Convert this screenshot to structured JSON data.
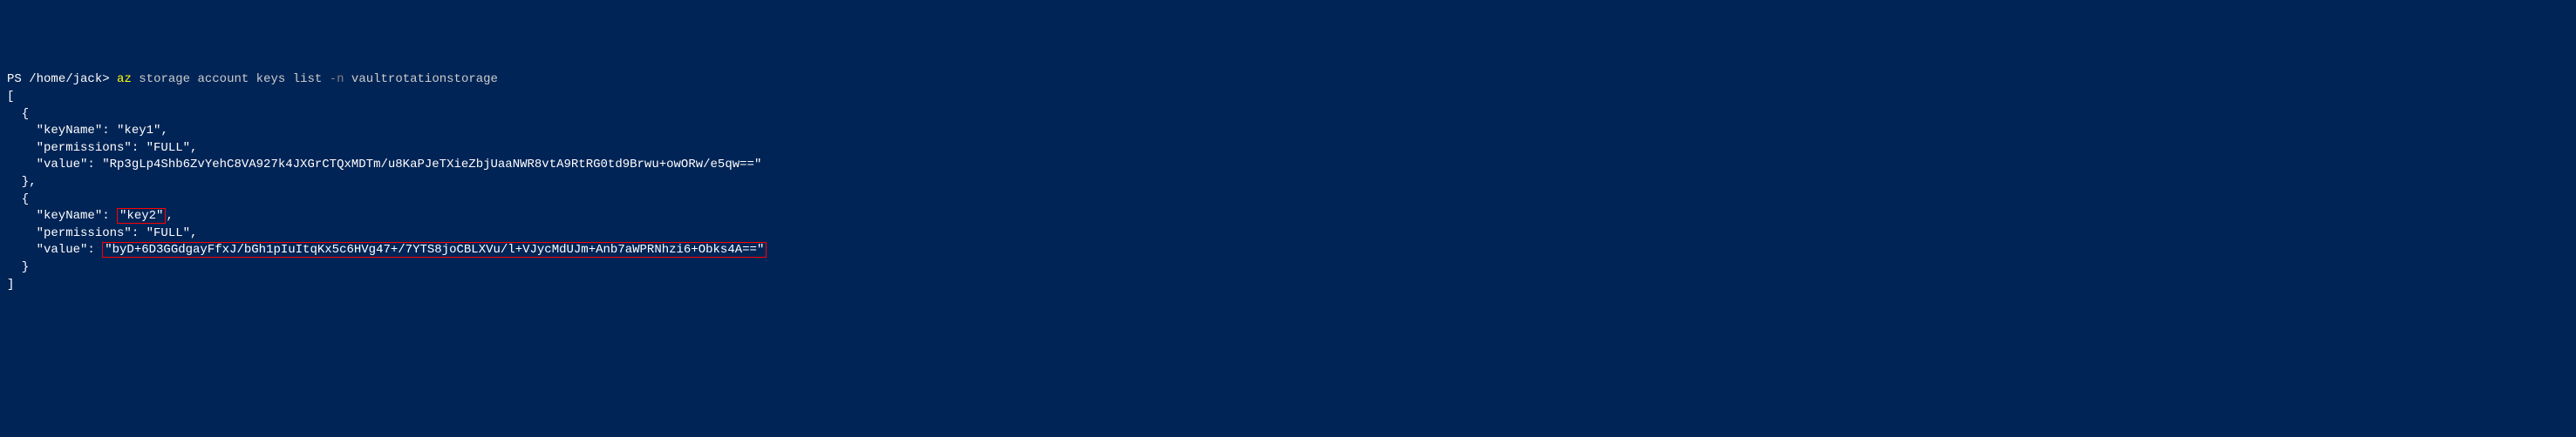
{
  "prompt": {
    "ps": "PS ",
    "path": "/home/jack>",
    "az": " az",
    "args": " storage account keys list ",
    "flag": "-n",
    "account": " vaultrotationstorage"
  },
  "output": {
    "open_bracket": "[",
    "obj1_open": "  {",
    "obj1_keyname_label": "    \"keyName\": ",
    "obj1_keyname_value": "\"key1\"",
    "obj1_keyname_comma": ",",
    "obj1_permissions": "    \"permissions\": \"FULL\",",
    "obj1_value_label": "    \"value\": ",
    "obj1_value_value": "\"Rp3gLp4Shb6ZvYehC8VA927k4JXGrCTQxMDTm/u8KaPJeTXieZbjUaaNWR8vtA9RtRG0td9Brwu+owORw/e5qw==\"",
    "obj1_close": "  },",
    "obj2_open": "  {",
    "obj2_keyname_label": "    \"keyName\": ",
    "obj2_keyname_value": "\"key2\"",
    "obj2_keyname_comma": ",",
    "obj2_permissions": "    \"permissions\": \"FULL\",",
    "obj2_value_label": "    \"value\": ",
    "obj2_value_value": "\"byD+6D3GGdgayFfxJ/bGh1pIuItqKx5c6HVg47+/7YTS8joCBLXVu/l+VJycMdUJm+Anb7aWPRNhzi6+Obks4A==\"",
    "obj2_close": "  }",
    "close_bracket": "]"
  }
}
